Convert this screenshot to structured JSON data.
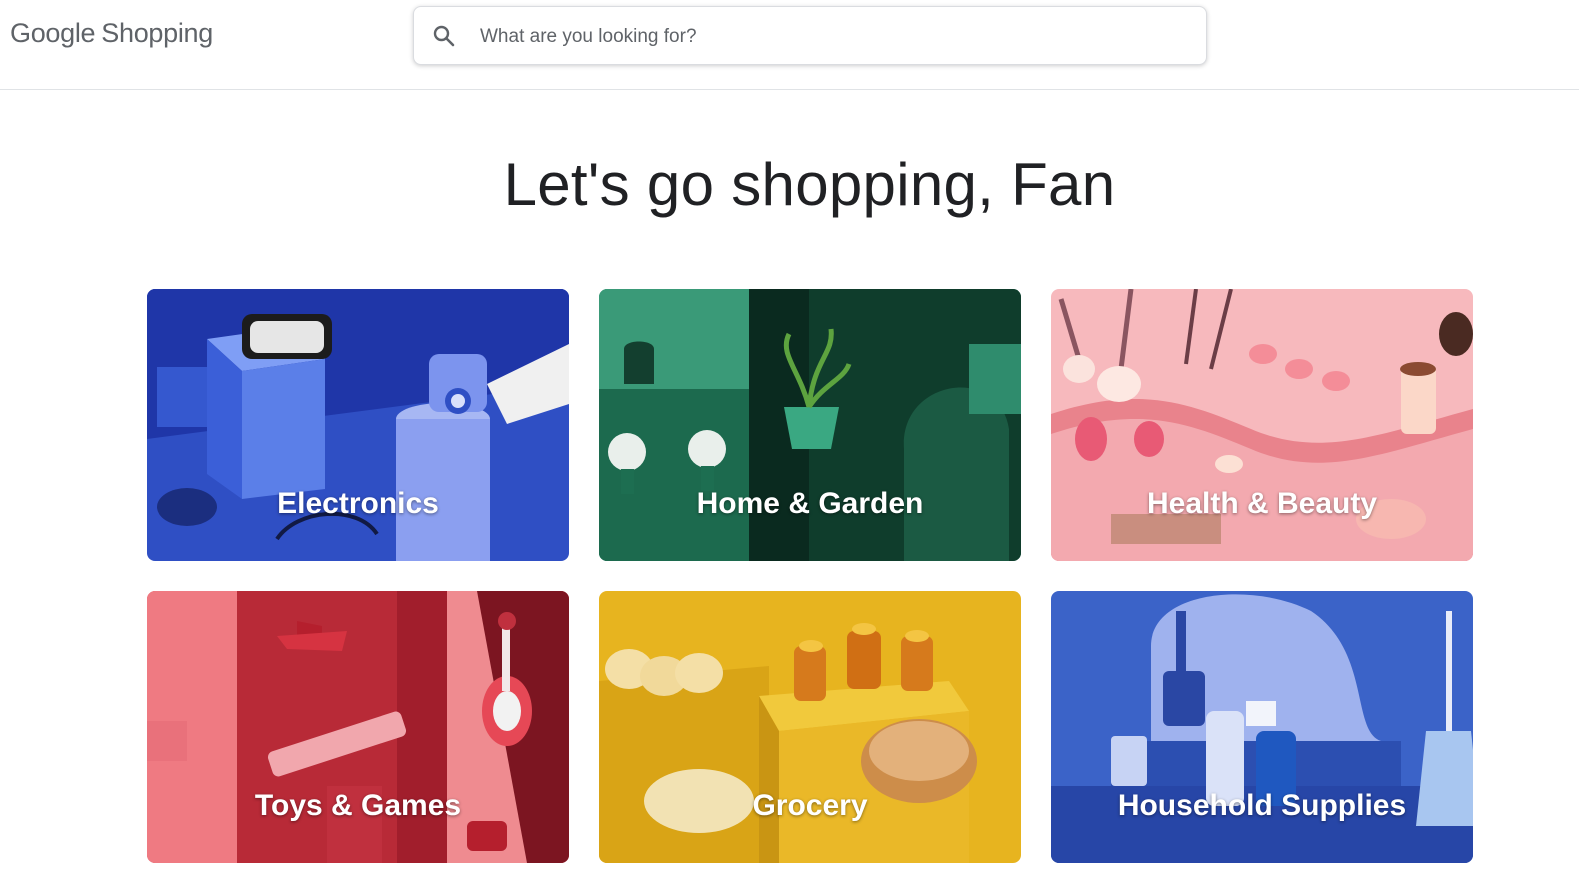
{
  "header": {
    "logo_brand": "Google",
    "logo_product": "Shopping",
    "search_placeholder": "What are you looking for?"
  },
  "greeting": "Let's go shopping, Fan",
  "categories": [
    {
      "label": "Electronics",
      "color": "#2b46b8"
    },
    {
      "label": "Home & Garden",
      "color": "#2f8c6d"
    },
    {
      "label": "Health & Beauty",
      "color": "#f2a2a8"
    },
    {
      "label": "Toys & Games",
      "color": "#c0303e"
    },
    {
      "label": "Grocery",
      "color": "#e0b21e"
    },
    {
      "label": "Household Supplies",
      "color": "#3c63c9"
    }
  ]
}
